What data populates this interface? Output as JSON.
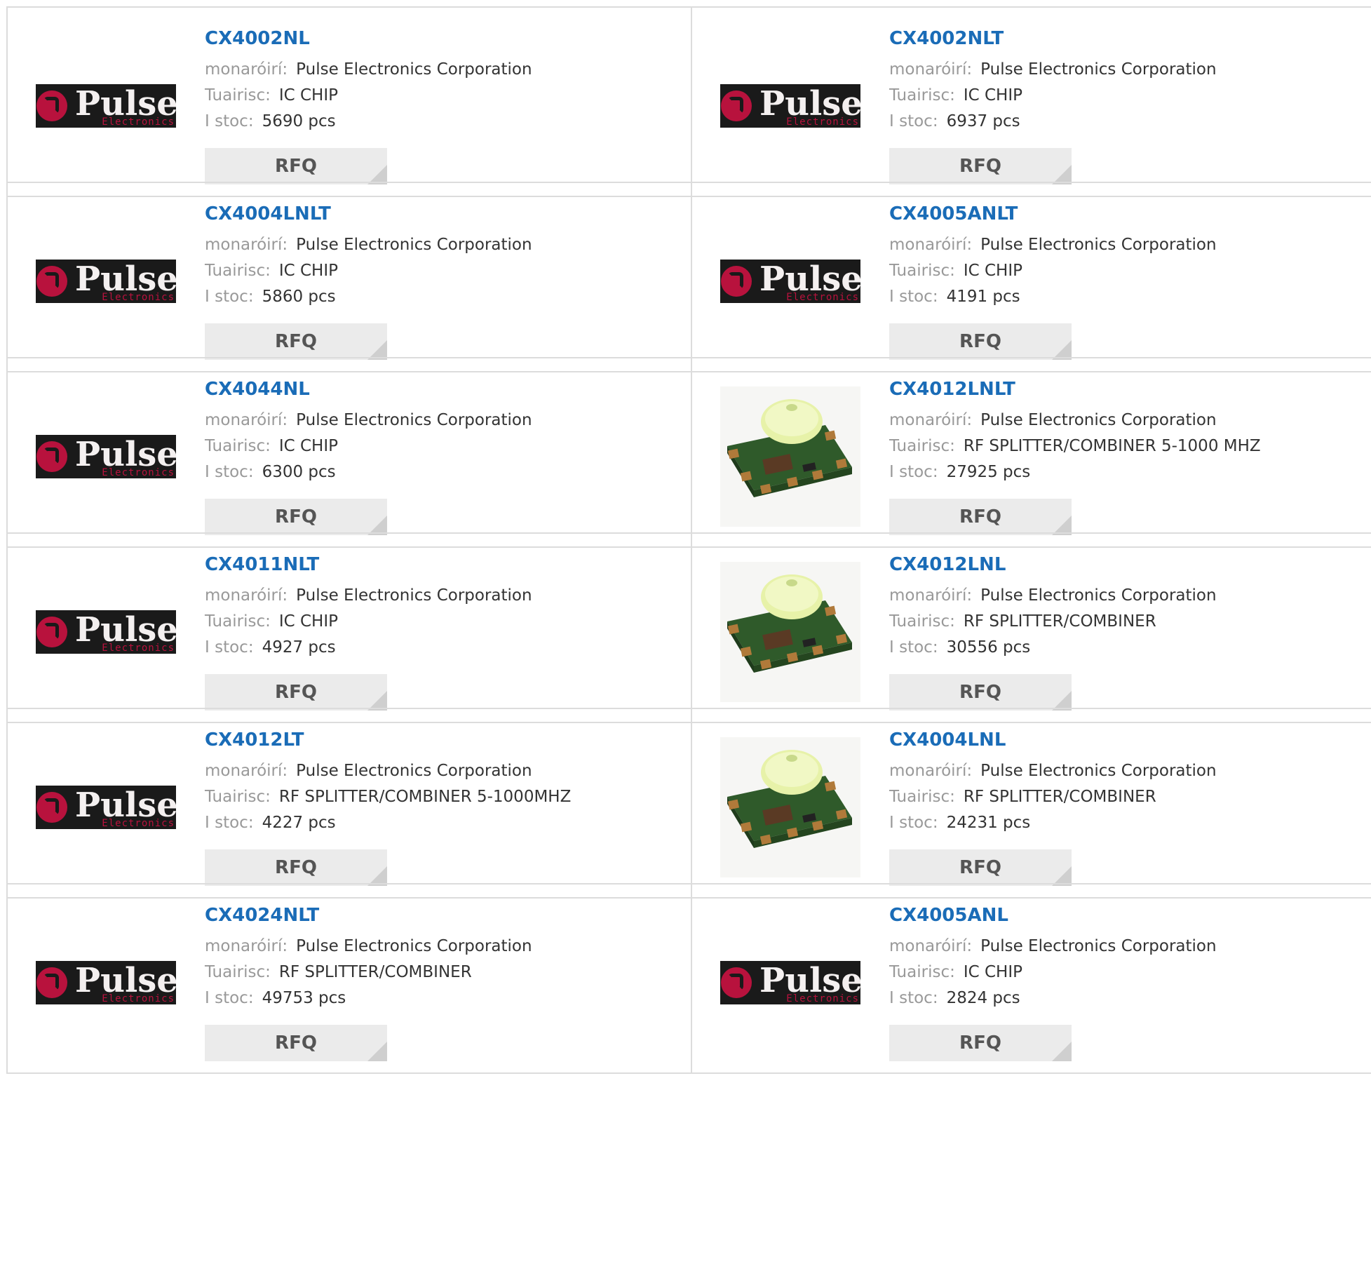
{
  "labels": {
    "manufacturer": "monaróirí:",
    "description": "Tuairisc:",
    "stock": "I stoc:",
    "rfq": "RFQ"
  },
  "colors": {
    "link": "#1a6cb7",
    "border": "#dcdcdc",
    "button_bg": "#ebebeb",
    "logo_red": "#b8123d"
  },
  "logo": {
    "brand": "Pulse",
    "sub": "Electronics"
  },
  "products": [
    {
      "part": "CX4002NL",
      "manufacturer": "Pulse Electronics Corporation",
      "description": "IC CHIP",
      "stock": "5690 pcs",
      "image": "pulse-logo"
    },
    {
      "part": "CX4002NLT",
      "manufacturer": "Pulse Electronics Corporation",
      "description": "IC CHIP",
      "stock": "6937 pcs",
      "image": "pulse-logo"
    },
    {
      "part": "CX4004LNLT",
      "manufacturer": "Pulse Electronics Corporation",
      "description": "IC CHIP",
      "stock": "5860 pcs",
      "image": "pulse-logo"
    },
    {
      "part": "CX4005ANLT",
      "manufacturer": "Pulse Electronics Corporation",
      "description": "IC CHIP",
      "stock": "4191 pcs",
      "image": "pulse-logo"
    },
    {
      "part": "CX4044NL",
      "manufacturer": "Pulse Electronics Corporation",
      "description": "IC CHIP",
      "stock": "6300 pcs",
      "image": "pulse-logo"
    },
    {
      "part": "CX4012LNLT",
      "manufacturer": "Pulse Electronics Corporation",
      "description": "RF SPLITTER/COMBINER 5-1000 MHZ",
      "stock": "27925 pcs",
      "image": "chip-photo"
    },
    {
      "part": "CX4011NLT",
      "manufacturer": "Pulse Electronics Corporation",
      "description": "IC CHIP",
      "stock": "4927 pcs",
      "image": "pulse-logo"
    },
    {
      "part": "CX4012LNL",
      "manufacturer": "Pulse Electronics Corporation",
      "description": "RF SPLITTER/COMBINER",
      "stock": "30556 pcs",
      "image": "chip-photo"
    },
    {
      "part": "CX4012LT",
      "manufacturer": "Pulse Electronics Corporation",
      "description": "RF SPLITTER/COMBINER 5-1000MHZ",
      "stock": "4227 pcs",
      "image": "pulse-logo"
    },
    {
      "part": "CX4004LNL",
      "manufacturer": "Pulse Electronics Corporation",
      "description": "RF SPLITTER/COMBINER",
      "stock": "24231 pcs",
      "image": "chip-photo"
    },
    {
      "part": "CX4024NLT",
      "manufacturer": "Pulse Electronics Corporation",
      "description": "RF SPLITTER/COMBINER",
      "stock": "49753 pcs",
      "image": "pulse-logo"
    },
    {
      "part": "CX4005ANL",
      "manufacturer": "Pulse Electronics Corporation",
      "description": "IC CHIP",
      "stock": "2824 pcs",
      "image": "pulse-logo"
    }
  ]
}
